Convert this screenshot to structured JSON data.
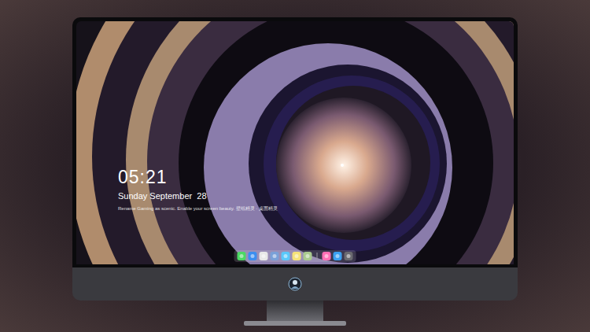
{
  "lock_screen": {
    "time": "05:21",
    "date": "Sunday September  28",
    "caption": "Rename Gaming as scenic. Enable your screen beauty. 壁纸精灵 · 桌面精灵"
  },
  "dock": {
    "items": [
      {
        "kind": "app",
        "color": "#4cd964"
      },
      {
        "kind": "app",
        "color": "#3b8ef0"
      },
      {
        "kind": "app",
        "color": "#e8e8e8"
      },
      {
        "kind": "app",
        "color": "#7aa0d8"
      },
      {
        "kind": "app",
        "color": "#5ac8fa"
      },
      {
        "kind": "app",
        "color": "#f5e27a"
      },
      {
        "kind": "app",
        "color": "#a9c98f"
      },
      {
        "kind": "divider",
        "color": "#9a9aa0"
      },
      {
        "kind": "app",
        "color": "#ff6fb5"
      },
      {
        "kind": "app",
        "color": "#3aa0f0"
      },
      {
        "kind": "app",
        "color": "#6a6a70"
      }
    ]
  }
}
